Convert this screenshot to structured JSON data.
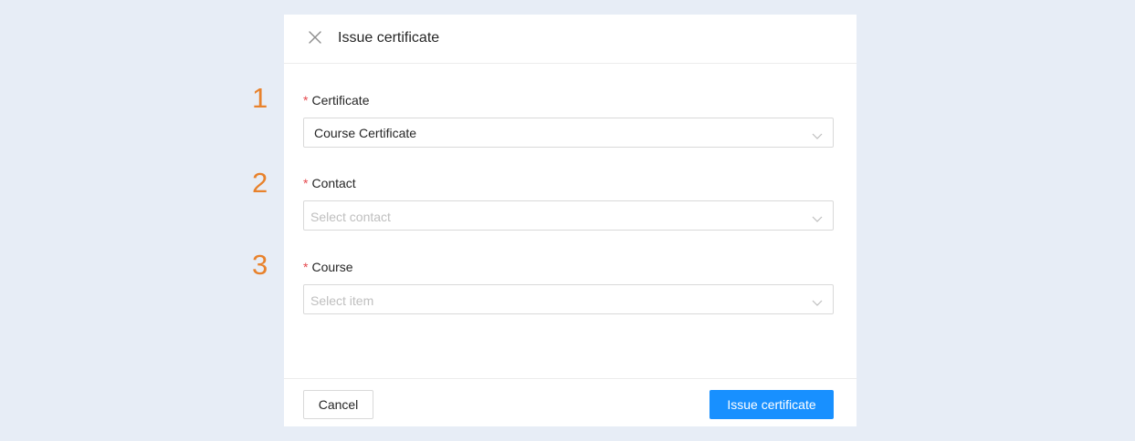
{
  "steps": [
    "1",
    "2",
    "3"
  ],
  "modal": {
    "title": "Issue certificate",
    "close_icon": "close-icon"
  },
  "fields": {
    "certificate": {
      "required": "*",
      "label": "Certificate",
      "value": "Course Certificate"
    },
    "contact": {
      "required": "*",
      "label": "Contact",
      "placeholder": "Select contact"
    },
    "course": {
      "required": "*",
      "label": "Course",
      "placeholder": "Select item"
    }
  },
  "footer": {
    "cancel_label": "Cancel",
    "issue_label": "Issue certificate"
  },
  "colors": {
    "background": "#e7edf6",
    "step_number": "#e8822c",
    "required": "#e5484d",
    "primary": "#1890ff"
  }
}
